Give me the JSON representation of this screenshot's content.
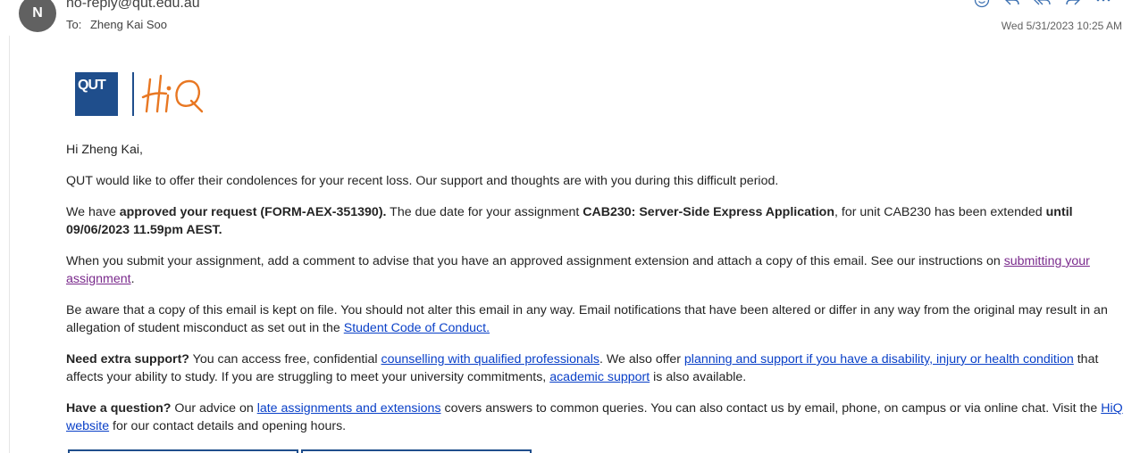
{
  "header": {
    "avatar_initial": "N",
    "sender": "no-reply@qut.edu.au",
    "to_label": "To:",
    "to_name": "Zheng Kai Soo",
    "timestamp": "Wed 5/31/2023 10:25 AM",
    "toolbar_icons": [
      "emoji-icon",
      "reply-icon",
      "reply-all-icon",
      "forward-icon",
      "more-icon"
    ]
  },
  "logo": {
    "qut_text": "QUT",
    "hiq_text": "HiQ",
    "qut_color": "#1f4e8c",
    "hiq_color": "#e87722"
  },
  "body": {
    "greeting": "Hi Zheng Kai,",
    "p1": "QUT would like to offer their condolences for your recent loss. Our support and thoughts are with you during this difficult period.",
    "p2_a": "We have ",
    "p2_b": "approved your request (FORM-AEX-351390).",
    "p2_c": " The due date for your assignment ",
    "p2_d": "CAB230: Server-Side Express Application",
    "p2_e": ", for unit CAB230 has been extended ",
    "p2_f": "until 09/06/2023 11.59pm AEST.",
    "p3_a": "When you submit your assignment, add a comment to advise that you have an approved assignment extension and attach a copy of this email. See our instructions on ",
    "p3_link": "submitting your assignment",
    "p3_b": ".",
    "p4_a": "Be aware that a copy of this email is kept on file. You should not alter this email in any way. Email notifications that have been altered or differ in any way from the original may result in an allegation of student misconduct as set out in the ",
    "p4_link": "Student Code of Conduct.",
    "p5_a": "Need extra support?",
    "p5_b": " You can access free, confidential ",
    "p5_link1": "counselling with qualified professionals",
    "p5_c": ". We also offer ",
    "p5_link2": "planning and support if you have a disability, injury or health condition",
    "p5_d": " that affects your ability to study. If you are struggling to meet your university commitments, ",
    "p5_link3": "academic support",
    "p5_e": " is also available.",
    "p6_a": "Have a question?",
    "p6_b": " Our advice on ",
    "p6_link1": "late assignments and extensions",
    "p6_c": " covers answers to common queries. You can also contact us by email, phone, on campus or via online chat. Visit the ",
    "p6_link2": "HiQ website",
    "p6_d": " for our contact details and opening hours."
  },
  "colors": {
    "link": "#0a40c8",
    "visited_link": "#7a2a8c",
    "accent": "#1f4e8c"
  }
}
